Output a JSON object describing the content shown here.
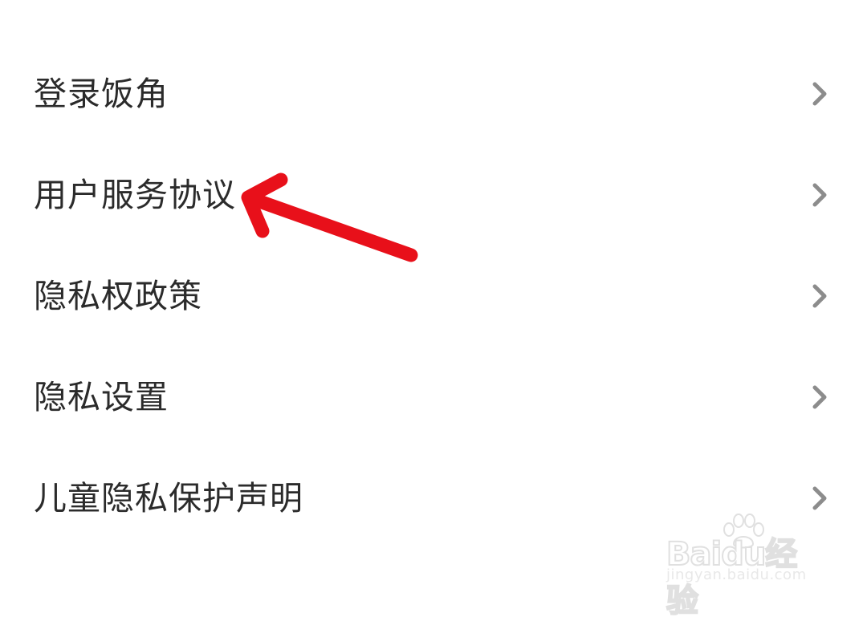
{
  "menu": {
    "items": [
      {
        "label": "登录饭角"
      },
      {
        "label": "用户服务协议"
      },
      {
        "label": "隐私权政策"
      },
      {
        "label": "隐私设置"
      },
      {
        "label": "儿童隐私保护声明"
      }
    ]
  },
  "annotation": {
    "color": "#e8101a",
    "icon": "red-arrow-pointing-left"
  },
  "colors": {
    "text": "#2b2b2b",
    "chevron": "#8c8c8c",
    "background": "#ffffff"
  },
  "watermark": {
    "brand": "Baidu经验",
    "url": "jingyan.baidu.com"
  }
}
